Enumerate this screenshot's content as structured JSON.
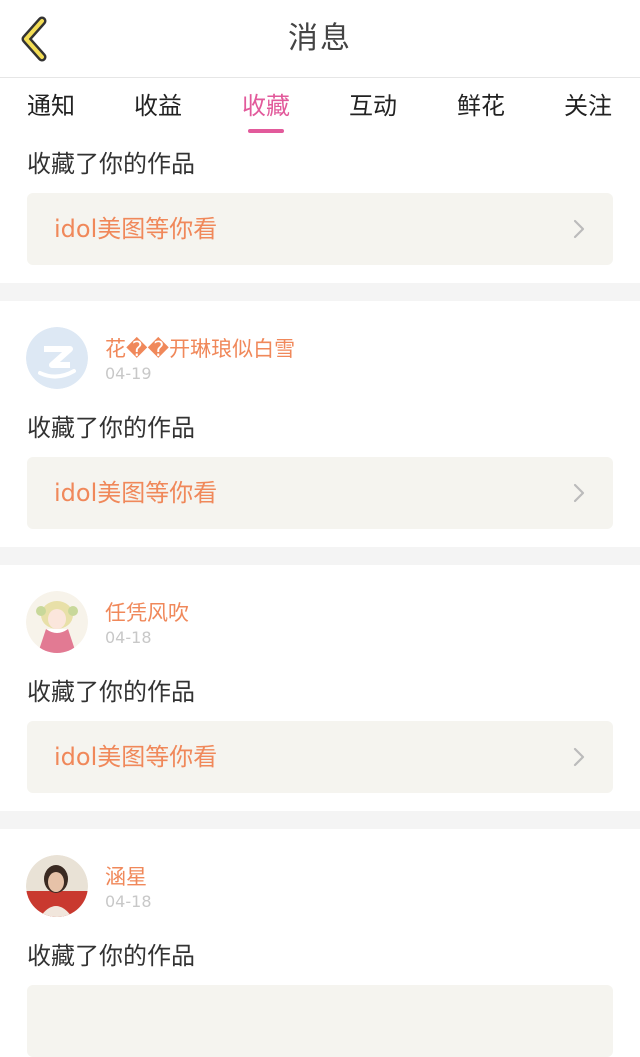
{
  "header": {
    "title": "消息",
    "back_icon": "chevron-left-icon"
  },
  "tabs": [
    {
      "label": "通知"
    },
    {
      "label": "收益"
    },
    {
      "label": "收藏",
      "active": true
    },
    {
      "label": "互动"
    },
    {
      "label": "鲜花"
    },
    {
      "label": "关注"
    }
  ],
  "colors": {
    "accent": "#e25a9b",
    "name": "#f0885a",
    "work_bg": "#f5f4ef"
  },
  "messages": [
    {
      "action": "收藏了你的作品",
      "work": "idol美图等你看"
    },
    {
      "user": "花��开琳琅似白雪",
      "date": "04-19",
      "action": "收藏了你的作品",
      "work": "idol美图等你看",
      "avatar": "qzone-default-avatar"
    },
    {
      "user": "任凭风吹",
      "date": "04-18",
      "action": "收藏了你的作品",
      "work": "idol美图等你看",
      "avatar": "anime-girl-avatar"
    },
    {
      "user": "涵星",
      "date": "04-18",
      "action": "收藏了你的作品",
      "work": "",
      "avatar": "photo-avatar"
    }
  ]
}
